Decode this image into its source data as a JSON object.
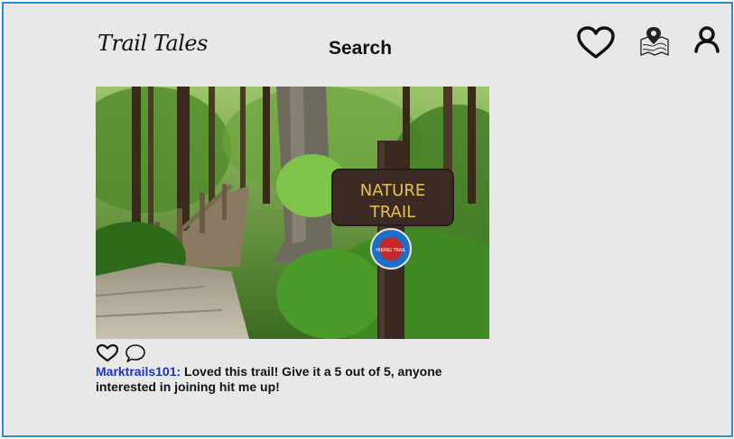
{
  "header": {
    "logo": "Trail Tales",
    "search_label": "Search"
  },
  "nav": {
    "icons": [
      "heart-icon",
      "map-location-icon",
      "user-icon"
    ]
  },
  "post": {
    "image_sign_line1": "NATURE",
    "image_sign_line2": "TRAIL",
    "image_badge": "HIKING TRAIL",
    "username": "Marktrails101:",
    "caption": " Loved this trail! Give it a 5 out of 5, anyone interested in joining hit me up!"
  },
  "colors": {
    "frame_border": "#2a8ed6",
    "background": "#e8e8e8",
    "username": "#1633c7"
  }
}
